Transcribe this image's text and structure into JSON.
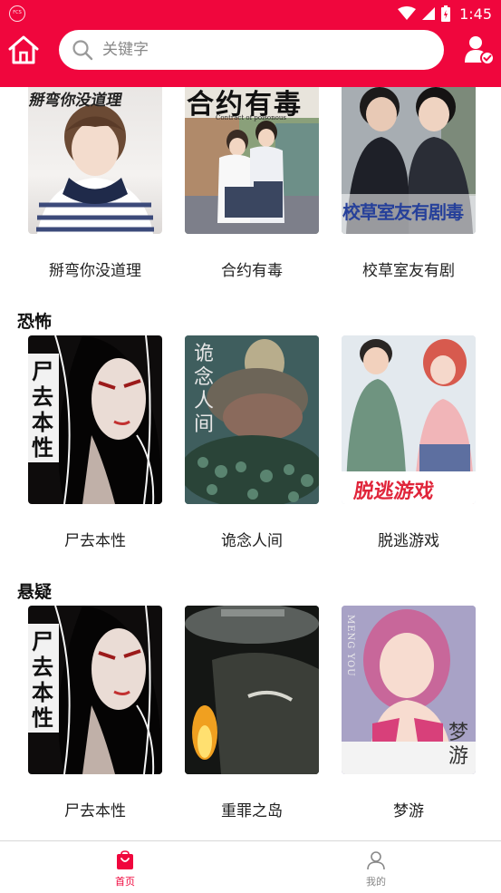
{
  "status_bar": {
    "time": "1:45"
  },
  "search": {
    "placeholder": "关键字"
  },
  "sections": [
    {
      "title": "",
      "books": [
        {
          "title": "掰弯你没道理",
          "cover_text": "掰弯你没道理"
        },
        {
          "title": "合约有毒",
          "cover_text": "合约有毒",
          "cover_subtext": "Contract of poisonous"
        },
        {
          "title": "校草室友有剧",
          "cover_text": "校草室友有剧毒"
        }
      ]
    },
    {
      "title": "恐怖",
      "books": [
        {
          "title": "尸去本性",
          "cover_text": "尸去本性"
        },
        {
          "title": "诡念人间",
          "cover_text": "诡念人间"
        },
        {
          "title": "脱逃游戏",
          "cover_text": "脱逃游戏"
        }
      ]
    },
    {
      "title": "悬疑",
      "books": [
        {
          "title": "尸去本性",
          "cover_text": "尸去本性"
        },
        {
          "title": "重罪之岛"
        },
        {
          "title": "梦游",
          "cover_text": "梦游",
          "cover_subtext": "MENG YOU"
        }
      ]
    }
  ],
  "bottom_nav": [
    {
      "label": "首页",
      "icon": "home-bag-icon",
      "active": true
    },
    {
      "label": "我的",
      "icon": "person-icon",
      "active": false
    }
  ],
  "colors": {
    "brand": "#f0063d",
    "active_tab": "#f0063d",
    "inactive_tab": "#888888"
  }
}
